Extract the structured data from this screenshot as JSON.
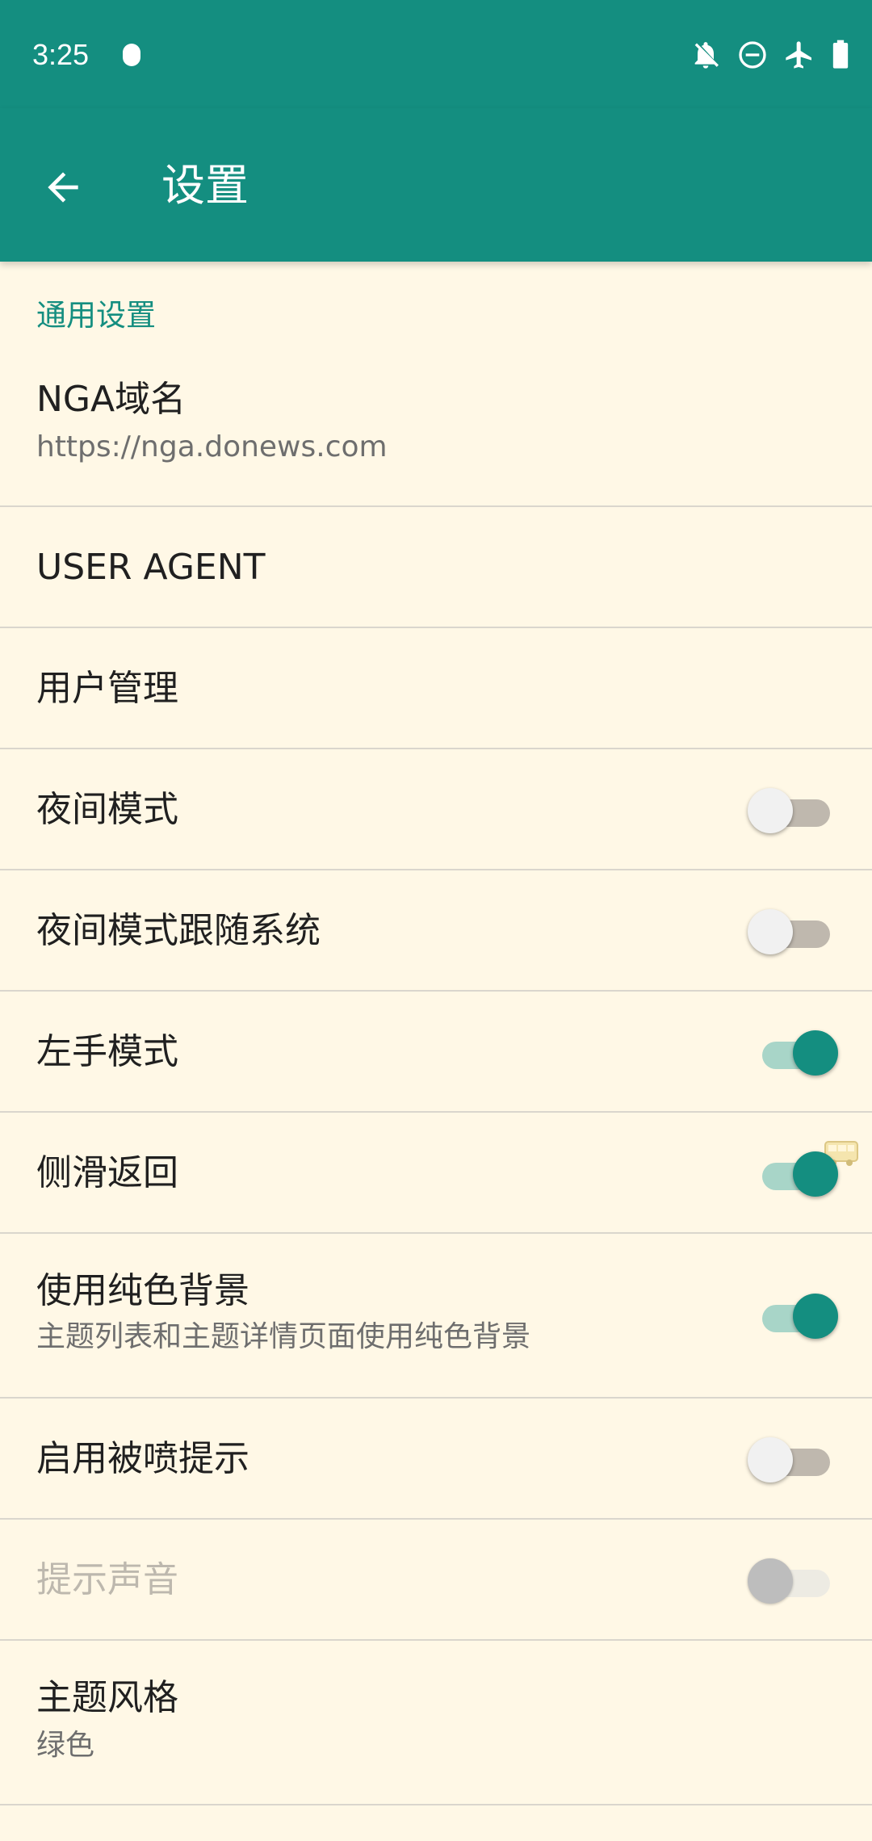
{
  "status_bar": {
    "time": "3:25",
    "icons": [
      "notification-dot-icon",
      "bell-off-icon",
      "do-not-disturb-icon",
      "airplane-icon",
      "battery-icon"
    ]
  },
  "toolbar": {
    "title": "设置",
    "back_icon": "arrow-back-icon"
  },
  "section": {
    "header": "通用设置"
  },
  "prefs": {
    "nga_domain": {
      "title": "NGA域名",
      "summary": "https://nga.donews.com"
    },
    "user_agent": {
      "title": "USER AGENT"
    },
    "user_manage": {
      "title": "用户管理"
    },
    "night_mode": {
      "title": "夜间模式",
      "checked": false
    },
    "night_follow_system": {
      "title": "夜间模式跟随系统",
      "checked": false
    },
    "left_hand": {
      "title": "左手模式",
      "checked": true
    },
    "swipe_back": {
      "title": "侧滑返回",
      "checked": true
    },
    "solid_bg": {
      "title": "使用纯色背景",
      "summary": "主题列表和主题详情页面使用纯色背景",
      "checked": true
    },
    "reply_notify": {
      "title": "启用被喷提示",
      "checked": false
    },
    "notify_sound": {
      "title": "提示声音",
      "checked": false,
      "enabled": false
    },
    "theme": {
      "title": "主题风格",
      "summary": "绿色"
    }
  },
  "colors": {
    "primary": "#148E80",
    "background": "#FFF8E6",
    "divider": "#DAD6CD",
    "switch_track_on": "#A8D5C8",
    "switch_track_off": "#BFB8AE"
  }
}
